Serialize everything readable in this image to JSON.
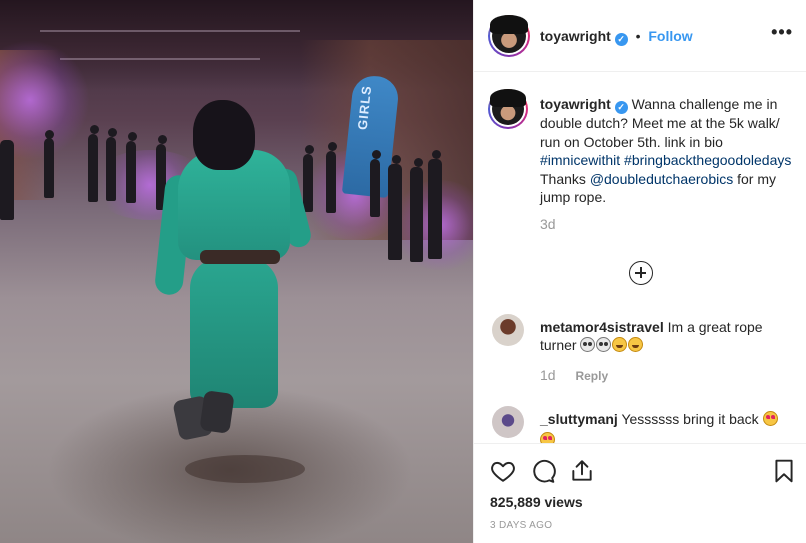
{
  "media": {
    "banner_text": "GIRLS"
  },
  "header": {
    "username": "toyawright",
    "verified_badge": "✓",
    "separator": "•",
    "follow_label": "Follow",
    "more_label": "•••"
  },
  "caption": {
    "username": "toyawright",
    "text": "Wanna challenge me in double dutch? Meet me at the 5k walk/ run on October 5th. link in bio",
    "hashtag1": "#imnicewithit",
    "hashtag2": "#bringbackthegoodoledays",
    "thanks_pre": "Thanks",
    "mention": "@doubledutchaerobics",
    "thanks_post": "for my jump rope.",
    "time": "3d"
  },
  "comments": [
    {
      "username": "metamor4sistravel",
      "text": "Im a great rope turner",
      "emojis": [
        "skull",
        "skull",
        "joy",
        "joy"
      ],
      "time": "1d",
      "reply_label": "Reply"
    },
    {
      "username": "_sluttymanj",
      "text": "Yessssss bring it back",
      "emojis": [
        "heart-eyes",
        "heart-eyes"
      ]
    }
  ],
  "actions": {
    "like_icon": "heart-icon",
    "comment_icon": "comment-icon",
    "share_icon": "share-icon",
    "save_icon": "bookmark-icon"
  },
  "stats": {
    "views": "825,889 views",
    "posted": "3 DAYS AGO"
  },
  "colors": {
    "accent": "#3897f0",
    "link": "#003569",
    "muted": "#999999",
    "outfit": "#2aa690"
  }
}
